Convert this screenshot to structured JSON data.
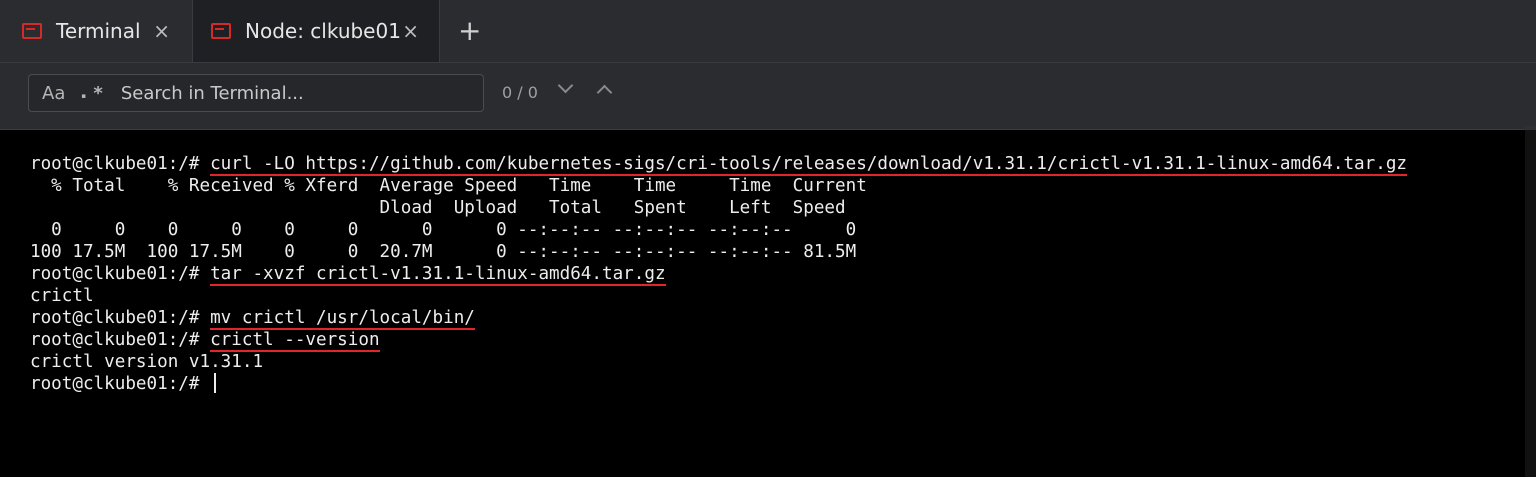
{
  "tabs": [
    {
      "label": "Terminal",
      "close": "×"
    },
    {
      "label": "Node: clkube01",
      "close": "×"
    }
  ],
  "add_tab": "+",
  "search": {
    "case_label": "Aa",
    "regex_label": "⠄*",
    "placeholder": "Search in Terminal...",
    "counter": "0 / 0"
  },
  "terminal": {
    "prompt": "root@clkube01:/# ",
    "lines": [
      {
        "prompt": "root@clkube01:/# ",
        "command": "curl -LO https://github.com/kubernetes-sigs/cri-tools/releases/download/v1.31.1/crictl-v1.31.1-linux-amd64.tar.gz"
      },
      {
        "output": "  % Total    % Received % Xferd  Average Speed   Time    Time     Time  Current"
      },
      {
        "output": "                                 Dload  Upload   Total   Spent    Left  Speed"
      },
      {
        "output": "  0     0    0     0    0     0      0      0 --:--:-- --:--:-- --:--:--     0"
      },
      {
        "output": "100 17.5M  100 17.5M    0     0  20.7M      0 --:--:-- --:--:-- --:--:-- 81.5M"
      },
      {
        "prompt": "root@clkube01:/# ",
        "command": "tar -xvzf crictl-v1.31.1-linux-amd64.tar.gz"
      },
      {
        "output": "crictl"
      },
      {
        "prompt": "root@clkube01:/# ",
        "command": "mv crictl /usr/local/bin/"
      },
      {
        "prompt": "root@clkube01:/# ",
        "command": "crictl --version"
      },
      {
        "output": "crictl version v1.31.1"
      }
    ]
  }
}
